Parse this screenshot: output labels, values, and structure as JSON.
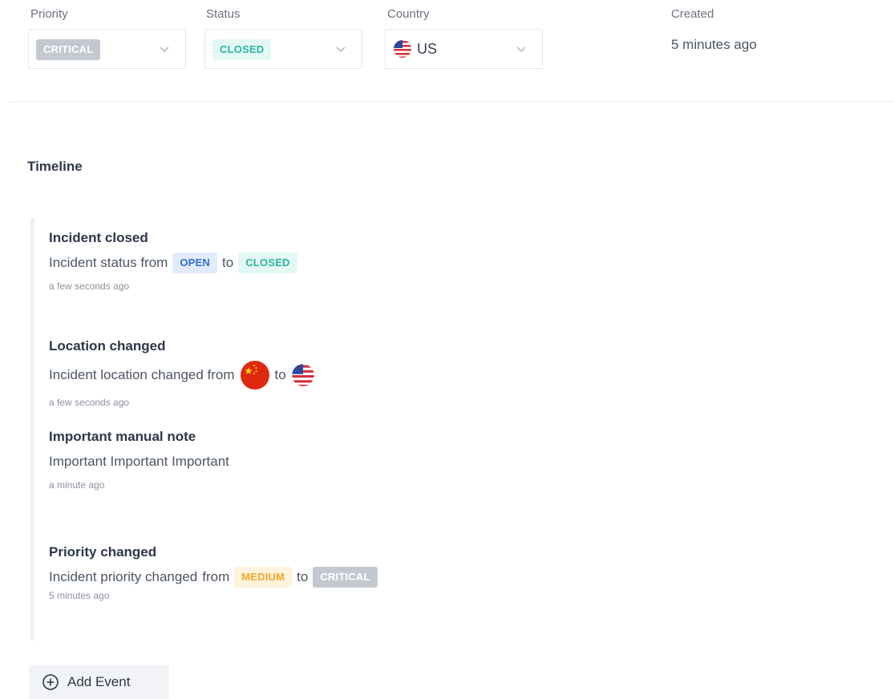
{
  "fields": {
    "priority": {
      "label": "Priority",
      "value": "CRITICAL"
    },
    "status": {
      "label": "Status",
      "value": "CLOSED"
    },
    "country": {
      "label": "Country",
      "value": "US",
      "flag_icon": "us-flag-icon"
    },
    "created": {
      "label": "Created",
      "value": "5 minutes ago"
    }
  },
  "timeline": {
    "title": "Timeline",
    "events": [
      {
        "title": "Incident closed",
        "prefix": "Incident status from",
        "from": "OPEN",
        "to_word": "to",
        "to": "CLOSED",
        "time": "a few seconds ago"
      },
      {
        "title": "Location changed",
        "prefix": "Incident location changed from",
        "from_icon": "china-flag-icon",
        "to_word": "to",
        "to_icon": "us-flag-icon",
        "time": "a few seconds ago"
      },
      {
        "title": "Important manual note",
        "body": "Important Important Important",
        "time": "a minute ago"
      },
      {
        "title": "Priority changed",
        "prefix": "Incident priority changed",
        "from_word": "from",
        "from": "MEDIUM",
        "to_word": "to",
        "to": "CRITICAL",
        "time": "5 minutes ago"
      }
    ]
  },
  "add_event": {
    "label": "Add Event",
    "icon": "plus-circle-icon"
  },
  "colors": {
    "critical": "#c4c9d1",
    "closed": "#2bb5a0",
    "open": "#2f6fd0",
    "medium": "#f5a623"
  }
}
